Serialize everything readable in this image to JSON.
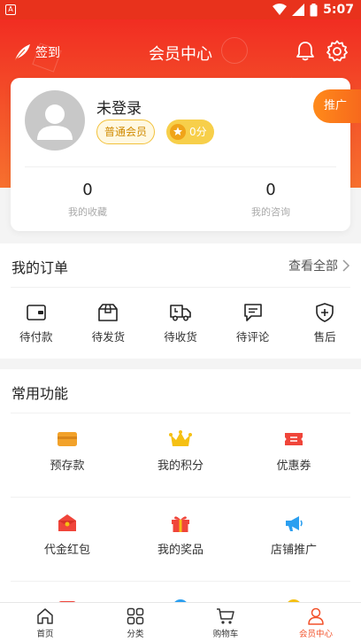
{
  "status_bar": {
    "time": "5:07",
    "app_badge": "A"
  },
  "header": {
    "checkin_label": "签到",
    "title": "会员中心"
  },
  "profile": {
    "username": "未登录",
    "member_level": "普通会员",
    "points": "0分",
    "promote_label": "推广",
    "stats": [
      {
        "value": "0",
        "label": "我的收藏"
      },
      {
        "value": "0",
        "label": "我的咨询"
      }
    ]
  },
  "orders": {
    "title": "我的订单",
    "view_all": "查看全部",
    "items": [
      {
        "label": "待付款",
        "icon": "wallet-icon"
      },
      {
        "label": "待发货",
        "icon": "box-icon"
      },
      {
        "label": "待收货",
        "icon": "truck-icon"
      },
      {
        "label": "待评论",
        "icon": "comment-icon"
      },
      {
        "label": "售后",
        "icon": "shield-plus-icon"
      }
    ]
  },
  "functions": {
    "title": "常用功能",
    "items": [
      {
        "label": "预存款",
        "icon": "card-icon",
        "color": "#f2a22a"
      },
      {
        "label": "我的积分",
        "icon": "crown-icon",
        "color": "#f5c013"
      },
      {
        "label": "优惠券",
        "icon": "coupon-icon",
        "color": "#f0453a"
      },
      {
        "label": "代金红包",
        "icon": "red-envelope-icon",
        "color": "#f0453a"
      },
      {
        "label": "我的奖品",
        "icon": "gift-icon",
        "color": "#f0453a"
      },
      {
        "label": "店铺推广",
        "icon": "megaphone-icon",
        "color": "#2b9ff0"
      }
    ]
  },
  "tabbar": {
    "items": [
      {
        "label": "首页",
        "icon": "home-icon"
      },
      {
        "label": "分类",
        "icon": "category-icon"
      },
      {
        "label": "购物车",
        "icon": "cart-icon"
      },
      {
        "label": "会员中心",
        "icon": "user-icon",
        "active": true
      }
    ]
  },
  "colors": {
    "brand": "#f12d22",
    "accent_orange": "#f7691c",
    "gold": "#f7cf4a"
  }
}
